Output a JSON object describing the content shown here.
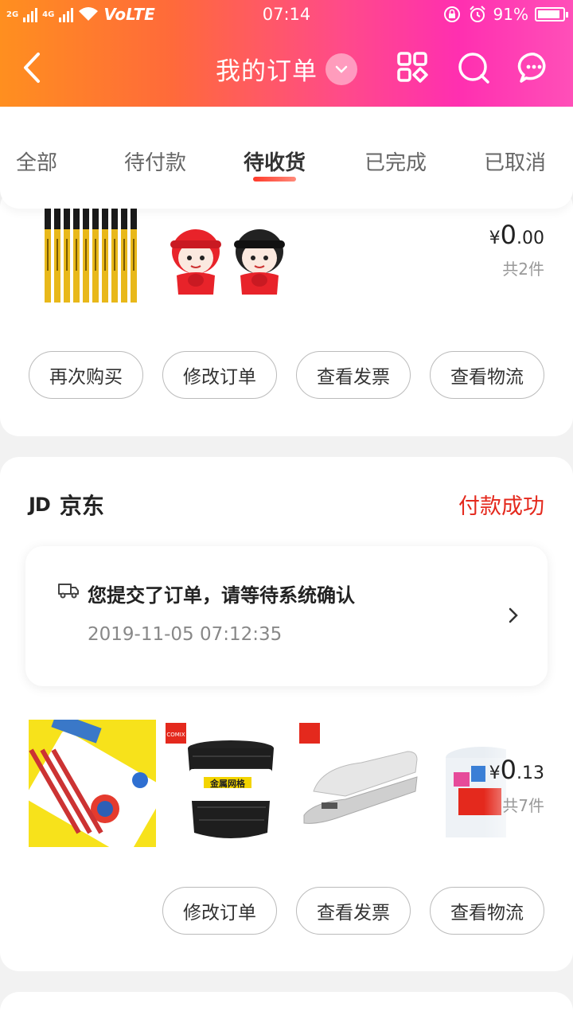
{
  "status_bar": {
    "network_1": "2G",
    "network_2": "4G",
    "carrier_label": "VoLTE",
    "time": "07:14",
    "battery": "91%"
  },
  "header": {
    "title": "我的订单",
    "icons": [
      "back-icon",
      "chevron-down-icon",
      "apps-icon",
      "search-icon",
      "message-icon"
    ]
  },
  "tabs": [
    {
      "label": "全部",
      "active": false
    },
    {
      "label": "待付款",
      "active": false
    },
    {
      "label": "待收货",
      "active": true
    },
    {
      "label": "已完成",
      "active": false
    },
    {
      "label": "已取消",
      "active": false
    }
  ],
  "orders": [
    {
      "price_symbol": "¥",
      "price_int": "0",
      "price_dec": ".00",
      "count": "共2件",
      "products": [
        "yellow-pencils",
        "figurine-sharpeners"
      ],
      "buttons": [
        "再次购买",
        "修改订单",
        "查看发票",
        "查看物流"
      ]
    },
    {
      "shop_logo": "JD",
      "shop_name": "京东",
      "status": "付款成功",
      "notice_text": "您提交了订单，请等待系统确认",
      "notice_time": "2019-11-05 07:12:35",
      "price_symbol": "¥",
      "price_int": "0",
      "price_dec": ".13",
      "count": "共7件",
      "products": [
        "pencils-box",
        "mesh-pen-holder",
        "stapler",
        "binder-clips"
      ],
      "brand_badge": "COMIX",
      "pen_holder_label": "金属网格",
      "buttons": [
        "修改订单",
        "查看发票",
        "查看物流"
      ]
    }
  ],
  "colors": {
    "accent_red": "#e4291d",
    "header_gradient_start": "#ff8f1f",
    "header_gradient_end": "#ff2fb0"
  }
}
